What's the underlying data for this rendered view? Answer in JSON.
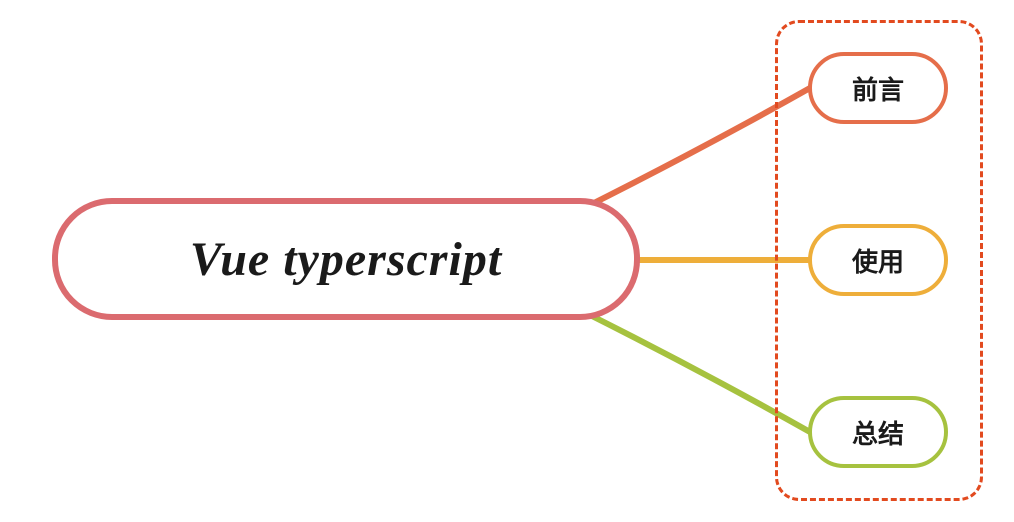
{
  "root": {
    "label": "Vue typerscript"
  },
  "children": [
    {
      "label": "前言",
      "color": "#e56e4a"
    },
    {
      "label": "使用",
      "color": "#eeae3a"
    },
    {
      "label": "总结",
      "color": "#a6c23f"
    }
  ]
}
